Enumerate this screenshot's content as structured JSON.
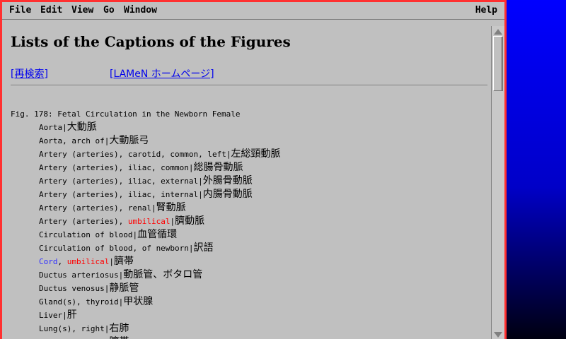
{
  "menubar": {
    "file": "File",
    "edit": "Edit",
    "view": "View",
    "go": "Go",
    "window": "Window",
    "help": "Help"
  },
  "page": {
    "title": "Lists of the Captions of the Figures",
    "links": {
      "research": "[再検索]",
      "home": "[LAMeN ホームページ]"
    },
    "figure": "Fig. 178: Fetal Circulation in the Newborn Female"
  },
  "entries": [
    {
      "en": "Aorta",
      "jp": "大動脈"
    },
    {
      "en": "Aorta, arch of",
      "jp": "大動脈弓"
    },
    {
      "en": "Artery (arteries), carotid, common, left",
      "jp": "左総頸動脈"
    },
    {
      "en": "Artery (arteries), iliac, common",
      "jp": "総腸骨動脈"
    },
    {
      "en": "Artery (arteries), iliac, external",
      "jp": "外腸骨動脈"
    },
    {
      "en": "Artery (arteries), iliac, internal",
      "jp": "内腸骨動脈"
    },
    {
      "en": "Artery (arteries), renal",
      "jp": "腎動脈"
    },
    {
      "en_prefix": "Artery (arteries), ",
      "en_red": "umbilical",
      "jp": "臍動脈"
    },
    {
      "en": "Circulation of blood",
      "jp": "血管循環"
    },
    {
      "en": "Circulation of blood, of newborn",
      "jp": "訳語"
    },
    {
      "en_blue": "Cord",
      "en_mid": ", ",
      "en_red": "umbilical",
      "jp": "臍帯"
    },
    {
      "en": "Ductus arteriosus",
      "jp": "動脈管、ボタロ管"
    },
    {
      "en": "Ductus venosus",
      "jp": "静脈管"
    },
    {
      "en": "Gland(s), thyroid",
      "jp": "甲状腺"
    },
    {
      "en": "Liver",
      "jp": "肝"
    },
    {
      "en": "Lung(s), right",
      "jp": "右肺"
    },
    {
      "en_red": "Umbilical cord",
      "jp": "臍帯"
    }
  ],
  "separator": "|",
  "colors": {
    "background": "#c0c0c0",
    "window_border": "#ff3030",
    "link": "#0000ee",
    "highlight_red": "#ff0000",
    "highlight_blue": "#3030ff",
    "desktop": "#0000ff"
  }
}
